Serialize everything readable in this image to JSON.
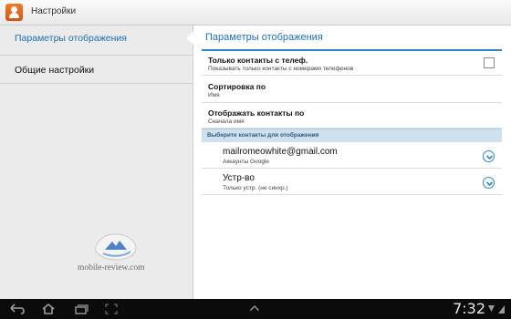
{
  "app": {
    "title": "Настройки",
    "icon": "contacts-person-icon"
  },
  "sidebar": {
    "items": [
      {
        "label": "Параметры отображения",
        "selected": true
      },
      {
        "label": "Общие настройки",
        "selected": false
      }
    ]
  },
  "watermark": {
    "text": "mobile-review.com"
  },
  "main": {
    "header": "Параметры отображения",
    "settings": [
      {
        "title": "Только контакты с телеф.",
        "summary": "Показывать только контакты с номерами телефонов",
        "control": "checkbox",
        "checked": false
      },
      {
        "title": "Сортировка  по",
        "summary": "Имя"
      },
      {
        "title": "Отображать контакты по",
        "summary": "Сначала имя"
      }
    ],
    "section_label": "Выберите контакты для отображения",
    "accounts": [
      {
        "name": "mailromeowhite@gmail.com",
        "type": "Аккаунты Google"
      },
      {
        "name": "Устр-во",
        "type": "Только устр. (не синхр.)"
      }
    ]
  },
  "system_bar": {
    "time": "7:32",
    "icons": [
      "back-icon",
      "home-icon",
      "recent-apps-icon",
      "screenshot-icon",
      "up-chevron-icon",
      "usb-icon",
      "signal-icon"
    ]
  },
  "colors": {
    "accent": "#1d70b5",
    "section": "#cfe0ee",
    "sidebar_bg": "#ebebeb"
  }
}
